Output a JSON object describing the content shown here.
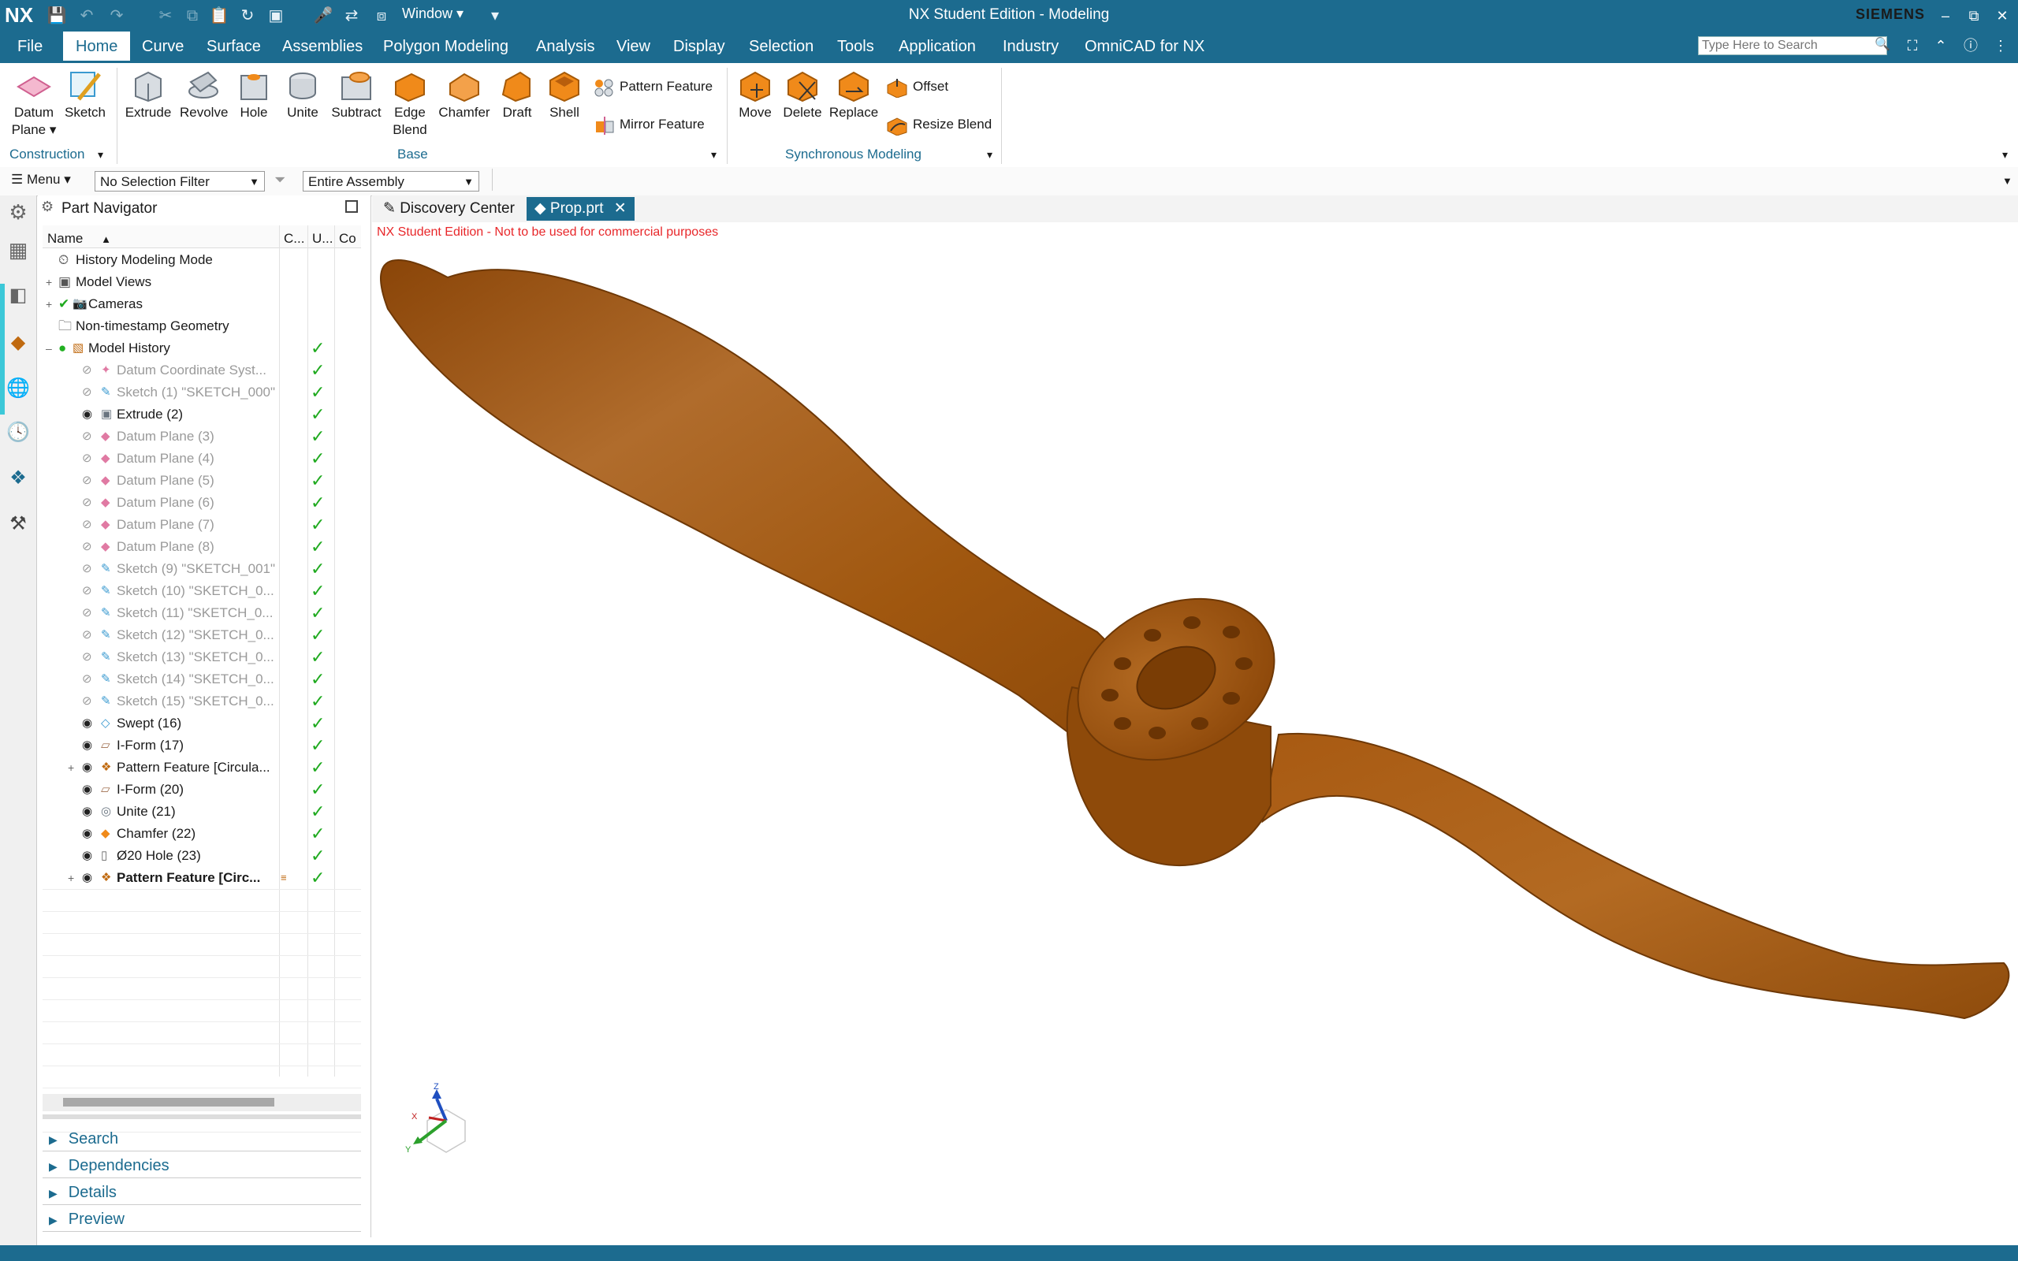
{
  "app": {
    "logo": "NX",
    "title": "NX Student Edition - Modeling",
    "brand": "SIEMENS",
    "window_menu": "Window"
  },
  "menu_tabs": [
    "File",
    "Home",
    "Curve",
    "Surface",
    "Assemblies",
    "Polygon Modeling",
    "Analysis",
    "View",
    "Display",
    "Selection",
    "Tools",
    "Application",
    "Industry",
    "OmniCAD for NX"
  ],
  "search": {
    "placeholder": "Type Here to Search"
  },
  "ribbon": {
    "construction": {
      "datum_plane": "Datum Plane",
      "sketch": "Sketch",
      "group": "Construction"
    },
    "base": {
      "extrude": "Extrude",
      "revolve": "Revolve",
      "hole": "Hole",
      "unite": "Unite",
      "subtract": "Subtract",
      "edge_blend": "Edge Blend",
      "chamfer": "Chamfer",
      "draft": "Draft",
      "shell": "Shell",
      "pattern_feature": "Pattern Feature",
      "mirror_feature": "Mirror Feature",
      "group": "Base"
    },
    "sync": {
      "move": "Move",
      "delete": "Delete",
      "replace": "Replace",
      "offset": "Offset",
      "resize_blend": "Resize Blend",
      "group": "Synchronous Modeling"
    }
  },
  "selbar": {
    "menu": "Menu",
    "filter": "No Selection Filter",
    "scope": "Entire Assembly"
  },
  "navigator": {
    "title": "Part Navigator",
    "columns": {
      "name": "Name",
      "c": "C...",
      "u": "U...",
      "co": "Co"
    },
    "rows": [
      {
        "label": "History Modeling Mode",
        "style": "normal",
        "check": false,
        "level": 0
      },
      {
        "label": "Model Views",
        "style": "normal",
        "check": false,
        "level": 0
      },
      {
        "label": "Cameras",
        "style": "normal",
        "check": false,
        "level": 0
      },
      {
        "label": "Non-timestamp Geometry",
        "style": "normal",
        "check": false,
        "level": 0
      },
      {
        "label": "Model History",
        "style": "normal",
        "check": true,
        "level": 0
      },
      {
        "label": "Datum Coordinate Syst...",
        "style": "gray",
        "check": true,
        "level": 1
      },
      {
        "label": "Sketch (1) \"SKETCH_000\"",
        "style": "gray",
        "check": true,
        "level": 1
      },
      {
        "label": "Extrude (2)",
        "style": "normal",
        "check": true,
        "level": 1
      },
      {
        "label": "Datum Plane (3)",
        "style": "gray",
        "check": true,
        "level": 1
      },
      {
        "label": "Datum Plane (4)",
        "style": "gray",
        "check": true,
        "level": 1
      },
      {
        "label": "Datum Plane (5)",
        "style": "gray",
        "check": true,
        "level": 1
      },
      {
        "label": "Datum Plane (6)",
        "style": "gray",
        "check": true,
        "level": 1
      },
      {
        "label": "Datum Plane (7)",
        "style": "gray",
        "check": true,
        "level": 1
      },
      {
        "label": "Datum Plane (8)",
        "style": "gray",
        "check": true,
        "level": 1
      },
      {
        "label": "Sketch (9) \"SKETCH_001\"",
        "style": "gray",
        "check": true,
        "level": 1
      },
      {
        "label": "Sketch (10) \"SKETCH_0...",
        "style": "gray",
        "check": true,
        "level": 1
      },
      {
        "label": "Sketch (11) \"SKETCH_0...",
        "style": "gray",
        "check": true,
        "level": 1
      },
      {
        "label": "Sketch (12) \"SKETCH_0...",
        "style": "gray",
        "check": true,
        "level": 1
      },
      {
        "label": "Sketch (13) \"SKETCH_0...",
        "style": "gray",
        "check": true,
        "level": 1
      },
      {
        "label": "Sketch (14) \"SKETCH_0...",
        "style": "gray",
        "check": true,
        "level": 1
      },
      {
        "label": "Sketch (15) \"SKETCH_0...",
        "style": "gray",
        "check": true,
        "level": 1
      },
      {
        "label": "Swept (16)",
        "style": "normal",
        "check": true,
        "level": 1
      },
      {
        "label": "I-Form (17)",
        "style": "normal",
        "check": true,
        "level": 1
      },
      {
        "label": "Pattern Feature [Circula...",
        "style": "normal",
        "check": true,
        "level": 1
      },
      {
        "label": "I-Form (20)",
        "style": "normal",
        "check": true,
        "level": 1
      },
      {
        "label": "Unite (21)",
        "style": "normal",
        "check": true,
        "level": 1
      },
      {
        "label": "Chamfer (22)",
        "style": "normal",
        "check": true,
        "level": 1
      },
      {
        "label": "Ø20 Hole (23)",
        "style": "normal",
        "check": true,
        "level": 1
      },
      {
        "label": "Pattern Feature [Circ...",
        "style": "bold",
        "check": true,
        "level": 1
      }
    ],
    "sections": [
      "Search",
      "Dependencies",
      "Details",
      "Preview"
    ]
  },
  "viewport": {
    "tabs": [
      "Discovery Center",
      "Prop.prt"
    ],
    "watermark": "NX Student Edition - Not to be used for commercial purposes"
  },
  "colors": {
    "accent": "#1c6b8f",
    "model": "#a85a12",
    "check": "#1faa1f",
    "watermark": "#e8272a"
  }
}
